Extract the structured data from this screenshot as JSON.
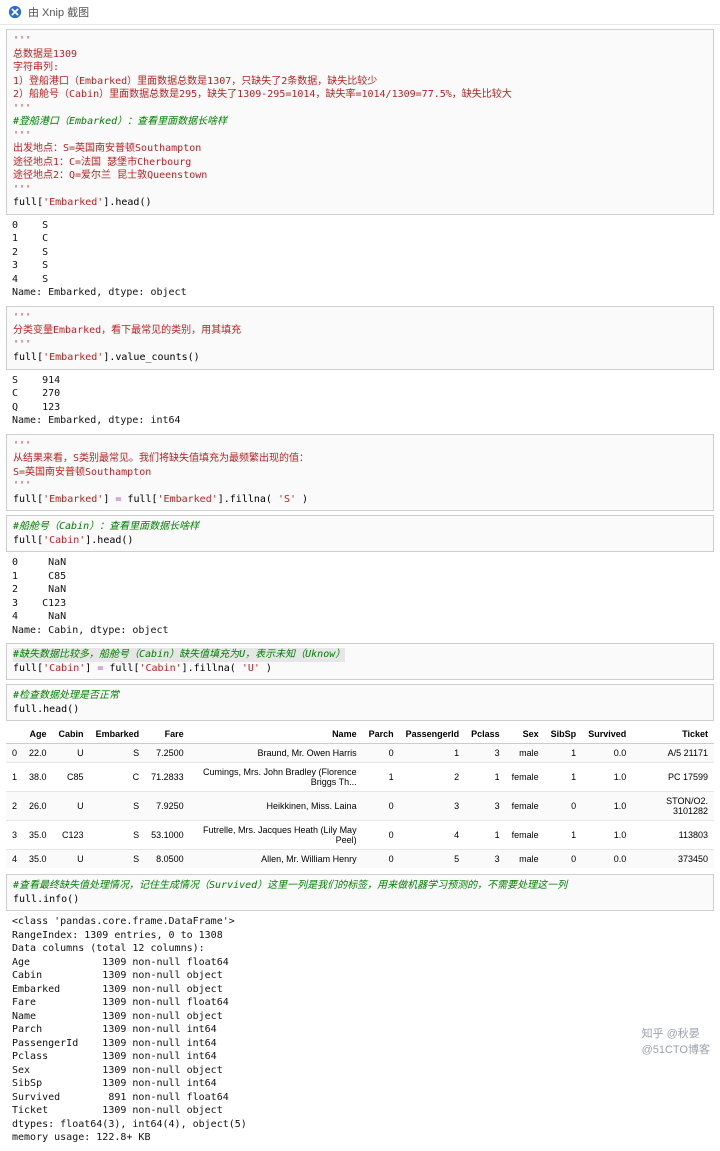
{
  "titlebar": {
    "label": "由 Xnip 截图"
  },
  "code1": {
    "tq1": "'''",
    "l1": "总数据是1309",
    "l2": "字符串列:",
    "l3": "1）登船港口（Embarked）里面数据总数是1307，只缺失了2条数据，缺失比较少",
    "l4": "2）船舱号（Cabin）里面数据总数是295，缺失了1309-295=1014，缺失率=1014/1309=77.5%，缺失比较大",
    "tq2": "'''",
    "cm": "#登船港口（Embarked）：查看里面数据长啥样",
    "tq3": "'''",
    "l5": "出发地点：S=英国南安普顿Southampton",
    "l6": "途径地点1：C=法国 瑟堡市Cherbourg",
    "l7": "途径地点2：Q=爱尔兰 昆士敦Queenstown",
    "tq4": "'''",
    "call_a": "full[",
    "arg1": "'Embarked'",
    "call_b": "].head()"
  },
  "out1": "0    S\n1    C\n2    S\n3    S\n4    S\nName: Embarked, dtype: object",
  "code2": {
    "tq1": "'''",
    "l1": "分类变量Embarked，看下最常见的类别，用其填充",
    "tq2": "'''",
    "call_a": "full[",
    "arg1": "'Embarked'",
    "call_b": "].value_counts()"
  },
  "out2": "S    914\nC    270\nQ    123\nName: Embarked, dtype: int64",
  "code3": {
    "tq1": "'''",
    "l1": "从结果来看，S类别最常见。我们将缺失值填充为最频繁出现的值：",
    "l2": "S=英国南安普顿Southampton",
    "tq2": "'''",
    "lhs_a": "full[",
    "lhs_b": "'Embarked'",
    "lhs_c": "] ",
    "op": "=",
    "rhs_a": " full[",
    "rhs_b": "'Embarked'",
    "rhs_c": "].fillna( ",
    "rhs_d": "'S'",
    "rhs_e": " )"
  },
  "code4": {
    "cm": "#船舱号（Cabin）：查看里面数据长啥样",
    "call_a": "full[",
    "arg1": "'Cabin'",
    "call_b": "].head()"
  },
  "out4": "0     NaN\n1     C85\n2     NaN\n3    C123\n4     NaN\nName: Cabin, dtype: object",
  "code5": {
    "cm": "#缺失数据比较多，船舱号（Cabin）缺失值填充为U，表示未知（Uknow）",
    "lhs_a": "full[",
    "lhs_b": "'Cabin'",
    "lhs_c": "] ",
    "op": "=",
    "rhs_a": " full[",
    "rhs_b": "'Cabin'",
    "rhs_c": "].fillna( ",
    "rhs_d": "'U'",
    "rhs_e": " )"
  },
  "code6": {
    "cm": "#检查数据处理是否正常",
    "call": "full.head()"
  },
  "table": {
    "headers": [
      "",
      "Age",
      "Cabin",
      "Embarked",
      "Fare",
      "Name",
      "Parch",
      "PassengerId",
      "Pclass",
      "Sex",
      "SibSp",
      "Survived",
      "Ticket"
    ],
    "rows": [
      [
        "0",
        "22.0",
        "U",
        "S",
        "7.2500",
        "Braund, Mr. Owen Harris",
        "0",
        "1",
        "3",
        "male",
        "1",
        "0.0",
        "A/5 21171"
      ],
      [
        "1",
        "38.0",
        "C85",
        "C",
        "71.2833",
        "Cumings, Mrs. John Bradley (Florence Briggs Th...",
        "1",
        "2",
        "1",
        "female",
        "1",
        "1.0",
        "PC 17599"
      ],
      [
        "2",
        "26.0",
        "U",
        "S",
        "7.9250",
        "Heikkinen, Miss. Laina",
        "0",
        "3",
        "3",
        "female",
        "0",
        "1.0",
        "STON/O2. 3101282"
      ],
      [
        "3",
        "35.0",
        "C123",
        "S",
        "53.1000",
        "Futrelle, Mrs. Jacques Heath (Lily May Peel)",
        "0",
        "4",
        "1",
        "female",
        "1",
        "1.0",
        "113803"
      ],
      [
        "4",
        "35.0",
        "U",
        "S",
        "8.0500",
        "Allen, Mr. William Henry",
        "0",
        "5",
        "3",
        "male",
        "0",
        "0.0",
        "373450"
      ]
    ]
  },
  "code7": {
    "cm": "#查看最终缺失值处理情况，记住生成情况（Survived）这里一列是我们的标签，用来做机器学习预测的，不需要处理这一列",
    "call": "full.info()"
  },
  "out7": "<class 'pandas.core.frame.DataFrame'>\nRangeIndex: 1309 entries, 0 to 1308\nData columns (total 12 columns):\nAge            1309 non-null float64\nCabin          1309 non-null object\nEmbarked       1309 non-null object\nFare           1309 non-null float64\nName           1309 non-null object\nParch          1309 non-null int64\nPassengerId    1309 non-null int64\nPclass         1309 non-null int64\nSex            1309 non-null object\nSibSp          1309 non-null int64\nSurvived        891 non-null float64\nTicket         1309 non-null object\ndtypes: float64(3), int64(4), object(5)\nmemory usage: 122.8+ KB",
  "watermark": {
    "a": "知乎 @秋晏",
    "b": "@51CTO博客"
  },
  "chart_data": {
    "type": "table",
    "title": "full.head()",
    "columns": [
      "Age",
      "Cabin",
      "Embarked",
      "Fare",
      "Name",
      "Parch",
      "PassengerId",
      "Pclass",
      "Sex",
      "SibSp",
      "Survived",
      "Ticket"
    ],
    "rows": [
      {
        "Age": 22.0,
        "Cabin": "U",
        "Embarked": "S",
        "Fare": 7.25,
        "Name": "Braund, Mr. Owen Harris",
        "Parch": 0,
        "PassengerId": 1,
        "Pclass": 3,
        "Sex": "male",
        "SibSp": 1,
        "Survived": 0.0,
        "Ticket": "A/5 21171"
      },
      {
        "Age": 38.0,
        "Cabin": "C85",
        "Embarked": "C",
        "Fare": 71.2833,
        "Name": "Cumings, Mrs. John Bradley (Florence Briggs Th...",
        "Parch": 1,
        "PassengerId": 2,
        "Pclass": 1,
        "Sex": "female",
        "SibSp": 1,
        "Survived": 1.0,
        "Ticket": "PC 17599"
      },
      {
        "Age": 26.0,
        "Cabin": "U",
        "Embarked": "S",
        "Fare": 7.925,
        "Name": "Heikkinen, Miss. Laina",
        "Parch": 0,
        "PassengerId": 3,
        "Pclass": 3,
        "Sex": "female",
        "SibSp": 0,
        "Survived": 1.0,
        "Ticket": "STON/O2. 3101282"
      },
      {
        "Age": 35.0,
        "Cabin": "C123",
        "Embarked": "S",
        "Fare": 53.1,
        "Name": "Futrelle, Mrs. Jacques Heath (Lily May Peel)",
        "Parch": 0,
        "PassengerId": 4,
        "Pclass": 1,
        "Sex": "female",
        "SibSp": 1,
        "Survived": 1.0,
        "Ticket": "113803"
      },
      {
        "Age": 35.0,
        "Cabin": "U",
        "Embarked": "S",
        "Fare": 8.05,
        "Name": "Allen, Mr. William Henry",
        "Parch": 0,
        "PassengerId": 5,
        "Pclass": 3,
        "Sex": "male",
        "SibSp": 0,
        "Survived": 0.0,
        "Ticket": "373450"
      }
    ]
  }
}
